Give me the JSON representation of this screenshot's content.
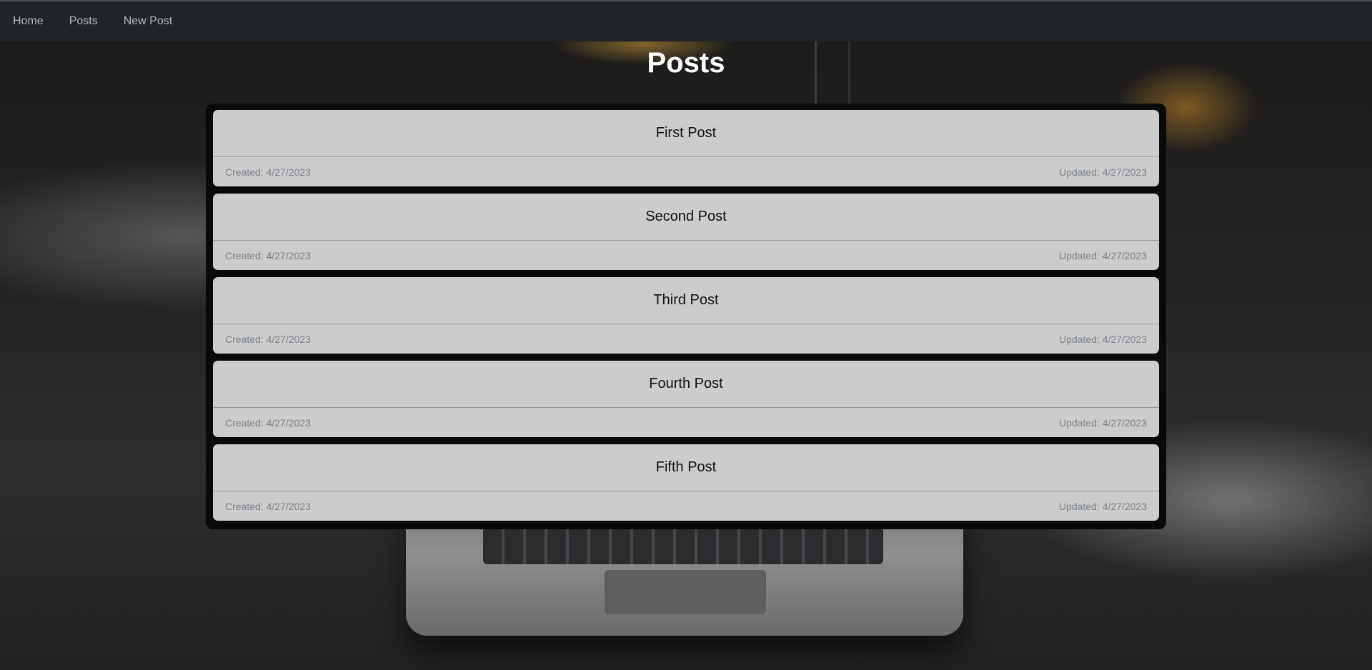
{
  "nav": {
    "items": [
      {
        "label": "Home"
      },
      {
        "label": "Posts"
      },
      {
        "label": "New Post"
      }
    ]
  },
  "page": {
    "title": "Posts"
  },
  "posts": [
    {
      "title": "First Post",
      "created": "Created: 4/27/2023",
      "updated": "Updated: 4/27/2023"
    },
    {
      "title": "Second Post",
      "created": "Created: 4/27/2023",
      "updated": "Updated: 4/27/2023"
    },
    {
      "title": "Third Post",
      "created": "Created: 4/27/2023",
      "updated": "Updated: 4/27/2023"
    },
    {
      "title": "Fourth Post",
      "created": "Created: 4/27/2023",
      "updated": "Updated: 4/27/2023"
    },
    {
      "title": "Fifth Post",
      "created": "Created: 4/27/2023",
      "updated": "Updated: 4/27/2023"
    }
  ],
  "colors": {
    "navbar": "#212529",
    "nav_text": "#b5b8bb",
    "card_bg": "#d0d0d0",
    "panel_bg": "#0a0a0a",
    "meta_text": "#7a8087"
  }
}
